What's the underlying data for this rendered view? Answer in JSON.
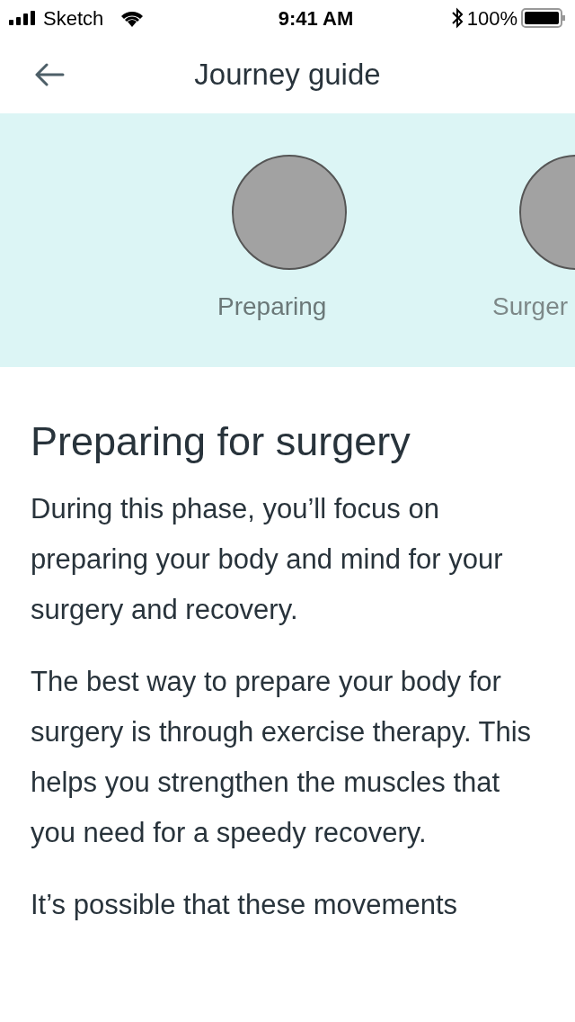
{
  "status_bar": {
    "carrier": "Sketch",
    "time": "9:41 AM",
    "battery": "100%"
  },
  "header": {
    "title": "Journey guide"
  },
  "phases": [
    {
      "label": "Preparing",
      "selected": true
    },
    {
      "label": "Surger",
      "selected": false
    }
  ],
  "article": {
    "title": "Preparing for surgery",
    "paragraphs": [
      "During this phase, you’ll focus on preparing your body and mind for your surgery and recovery.",
      "The best way to prepare your body for surgery is through exercise therapy. This helps you strengthen the muscles that you need for a speedy recovery.",
      "It’s possible that these movements"
    ]
  }
}
